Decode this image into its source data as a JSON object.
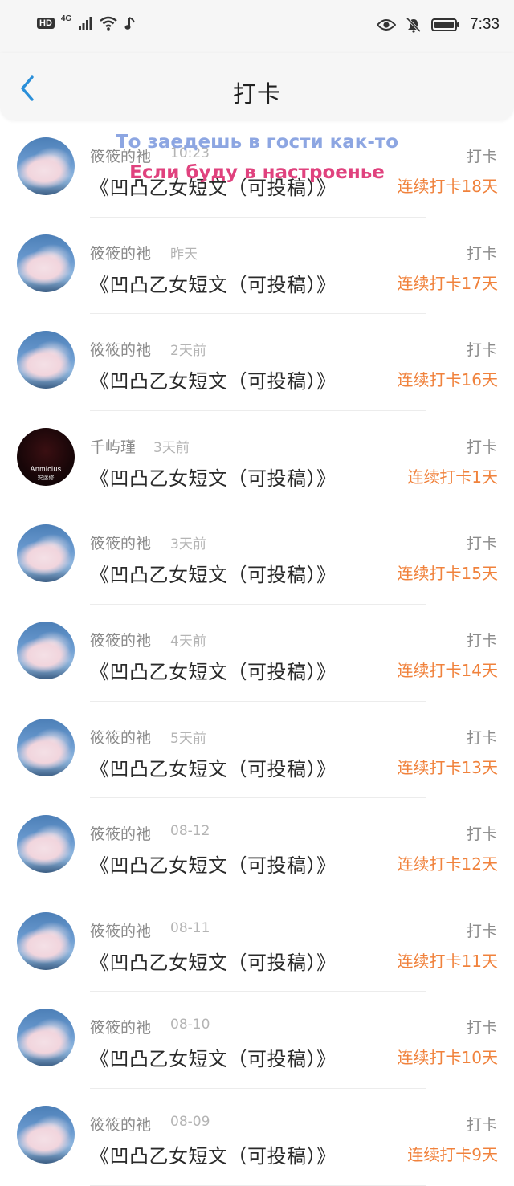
{
  "status_bar": {
    "hd": "HD",
    "network": "4G",
    "time": "7:33"
  },
  "header": {
    "title": "打卡"
  },
  "overlay": {
    "line1": "То заедешь в гости как-то",
    "line2": "Если буду в настроенье"
  },
  "colors": {
    "accent": "#2a8fd9",
    "streak": "#f0823c"
  },
  "feed": [
    {
      "user": "筱筱的祂",
      "time": "10:23",
      "action": "打卡",
      "content": "《凹凸乙女短文（可投稿）》",
      "streak": "连续打卡18天",
      "avatar": "cloud"
    },
    {
      "user": "筱筱的祂",
      "time": "昨天",
      "action": "打卡",
      "content": "《凹凸乙女短文（可投稿）》",
      "streak": "连续打卡17天",
      "avatar": "cloud"
    },
    {
      "user": "筱筱的祂",
      "time": "2天前",
      "action": "打卡",
      "content": "《凹凸乙女短文（可投稿）》",
      "streak": "连续打卡16天",
      "avatar": "cloud"
    },
    {
      "user": "千屿瑾",
      "time": "3天前",
      "action": "打卡",
      "content": "《凹凸乙女短文（可投稿）》",
      "streak": "连续打卡1天",
      "avatar": "dark",
      "avatar_text": "Anmicius",
      "avatar_sub": "安迷修"
    },
    {
      "user": "筱筱的祂",
      "time": "3天前",
      "action": "打卡",
      "content": "《凹凸乙女短文（可投稿）》",
      "streak": "连续打卡15天",
      "avatar": "cloud"
    },
    {
      "user": "筱筱的祂",
      "time": "4天前",
      "action": "打卡",
      "content": "《凹凸乙女短文（可投稿）》",
      "streak": "连续打卡14天",
      "avatar": "cloud"
    },
    {
      "user": "筱筱的祂",
      "time": "5天前",
      "action": "打卡",
      "content": "《凹凸乙女短文（可投稿）》",
      "streak": "连续打卡13天",
      "avatar": "cloud"
    },
    {
      "user": "筱筱的祂",
      "time": "08-12",
      "action": "打卡",
      "content": "《凹凸乙女短文（可投稿）》",
      "streak": "连续打卡12天",
      "avatar": "cloud"
    },
    {
      "user": "筱筱的祂",
      "time": "08-11",
      "action": "打卡",
      "content": "《凹凸乙女短文（可投稿）》",
      "streak": "连续打卡11天",
      "avatar": "cloud"
    },
    {
      "user": "筱筱的祂",
      "time": "08-10",
      "action": "打卡",
      "content": "《凹凸乙女短文（可投稿）》",
      "streak": "连续打卡10天",
      "avatar": "cloud"
    },
    {
      "user": "筱筱的祂",
      "time": "08-09",
      "action": "打卡",
      "content": "《凹凸乙女短文（可投稿）》",
      "streak": "连续打卡9天",
      "avatar": "cloud"
    }
  ]
}
